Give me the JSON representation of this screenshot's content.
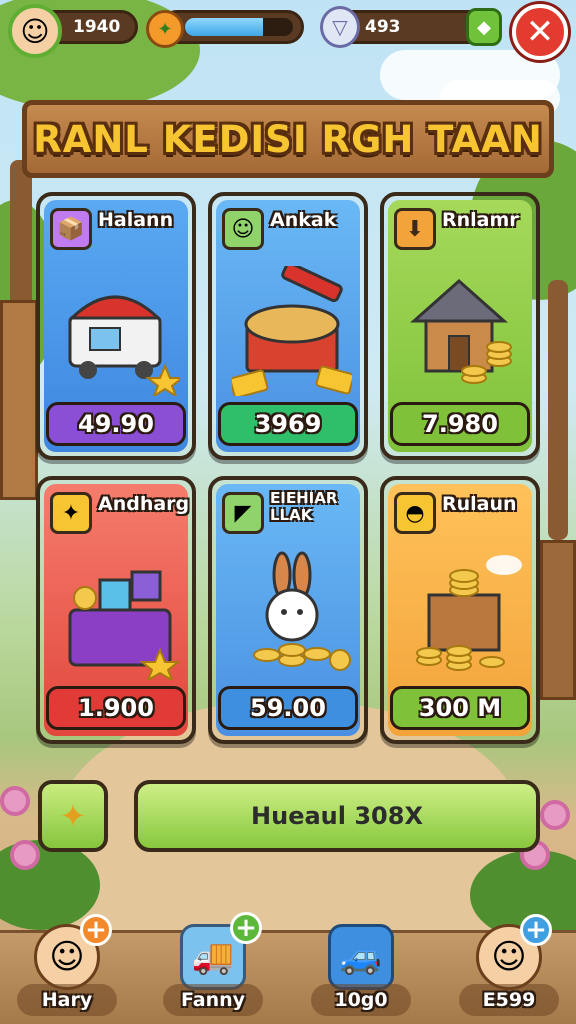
{
  "topbar": {
    "player_score": "1940",
    "energy_fill": 0.72,
    "currency_amount": "493"
  },
  "banner": {
    "title": "RANL KEDISI RGH TAAN"
  },
  "cards": [
    {
      "title": "Halann",
      "price": "49.90"
    },
    {
      "title": "Ankak",
      "price": "3969"
    },
    {
      "title": "Rnlamr",
      "price": "7.980"
    },
    {
      "title": "Andharg",
      "price": "1.900"
    },
    {
      "title": "EIEHIAR LLAK",
      "price": "59.00"
    },
    {
      "title": "Rulaun",
      "price": "300 M"
    }
  ],
  "actions": {
    "main_button": "Hueaul 308X"
  },
  "dock": [
    {
      "label": "Hary"
    },
    {
      "label": "Fanny"
    },
    {
      "label": "10g0"
    },
    {
      "label": "E599"
    }
  ],
  "colors": {
    "purple_price": "#8b4fd6",
    "green_price": "#2fbf6b",
    "lime_price": "#7fc23a",
    "red_price": "#e23a36",
    "blue_price": "#3f8fe0",
    "close": "#e33b2f"
  }
}
